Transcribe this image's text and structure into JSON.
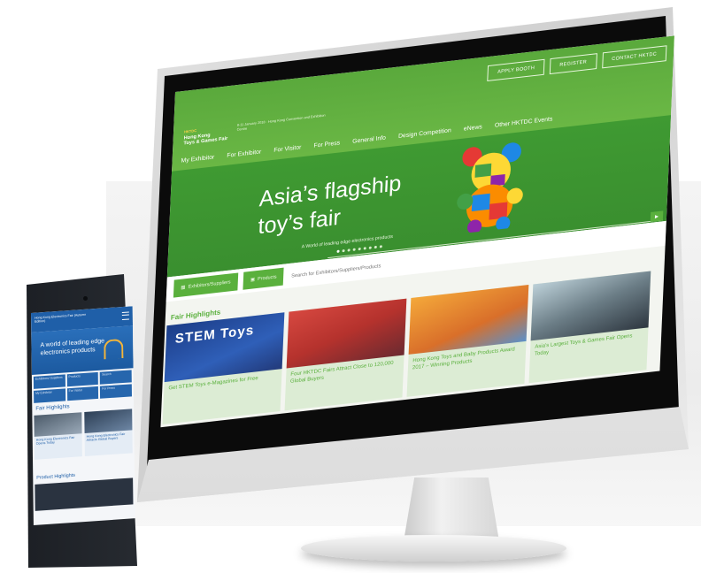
{
  "desktop": {
    "top_buttons": [
      "APPLY BOOTH",
      "REGISTER",
      "CONTACT HKTDC"
    ],
    "logo": {
      "lines": [
        "HKTDC",
        "Hong Kong",
        "Toys & Games Fair"
      ],
      "tagline": "8-11 January 2018 · Hong Kong Convention and Exhibition Centre"
    },
    "nav": [
      "My Exhibitor",
      "For Exhibitor",
      "For Visitor",
      "For Press",
      "General Info",
      "Design Competition",
      "eNews",
      "Other HKTDC Events"
    ],
    "hero": {
      "title_line1": "Asia’s flagship",
      "title_line2": "toy’s fair",
      "subtitle": "A World of leading edge electronics products"
    },
    "search": {
      "tab_exhibitors": "Exhibitors/Suppliers",
      "tab_products": "Products",
      "placeholder": "Search for Exhibitors/Suppliers/Products"
    },
    "highlights_title": "Fair Highlights",
    "cards": [
      {
        "caption": "Get STEM Toys e-Magazines for Free",
        "image_text": "STEM Toys"
      },
      {
        "caption": "Four HKTDC Fairs Attract Close to 120,000 Global Buyers"
      },
      {
        "caption": "Hong Kong Toys and Baby Products Award 2017 – Winning Products"
      },
      {
        "caption": "Asia's Largest Toys & Games Fair Opens Today"
      }
    ],
    "colors": {
      "brand_green": "#5ab03d",
      "hero_green": "#3f9a32"
    }
  },
  "mobile": {
    "logo": "Hong Kong Electronics Fair (Autumn Edition)",
    "hero_title_line1": "A world of leading edge",
    "hero_title_line2": "electronics products",
    "grid": [
      "Exhibitors/ Suppliers",
      "Products",
      "Search",
      "My Exhibitor",
      "For Visitor",
      "For Press"
    ],
    "fair_highlights": "Fair Highlights",
    "cards": [
      {
        "caption": "Hong Kong Electronics Fair Opens Today"
      },
      {
        "caption": "Hong Kong Electronics Fair Attracts Global Buyers"
      }
    ],
    "product_highlights": "Product Highlights",
    "colors": {
      "brand_blue": "#1f5fa8"
    }
  }
}
